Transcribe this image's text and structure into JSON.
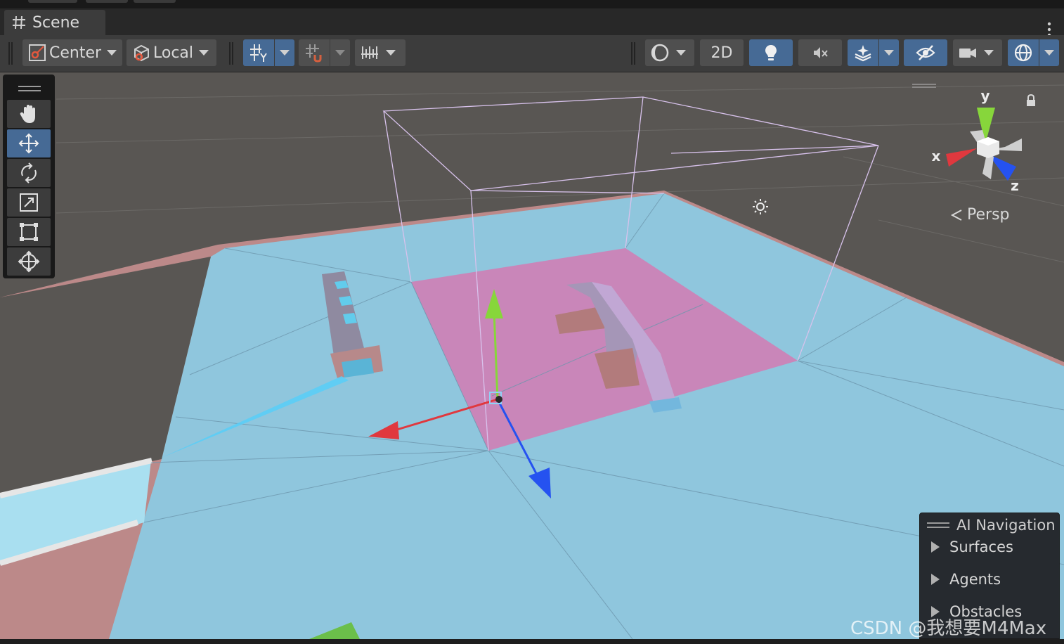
{
  "window": {
    "tab_title": "Scene"
  },
  "toolbar": {
    "pivot_label": "Center",
    "space_label": "Local",
    "mode_2d_label": "2D"
  },
  "tools": [
    "hand-tool",
    "move-tool",
    "rotate-tool",
    "scale-tool",
    "rect-tool",
    "transform-tool"
  ],
  "active_tool": "move-tool",
  "gizmo": {
    "y_label": "y",
    "x_label": "x",
    "z_label": "z",
    "projection_label": "Persp"
  },
  "overlay": {
    "title": "AI Navigation",
    "items": [
      {
        "label": "Surfaces"
      },
      {
        "label": "Agents"
      },
      {
        "label": "Obstacles"
      }
    ]
  },
  "watermark": "CSDN @我想要M4Max",
  "colors": {
    "active_button": "#466a95",
    "navmesh": "#8fd0ea",
    "selected_surface": "#d47ab8",
    "axis_x": "#e0383e",
    "axis_y": "#87d63b",
    "axis_z": "#2552f0"
  }
}
